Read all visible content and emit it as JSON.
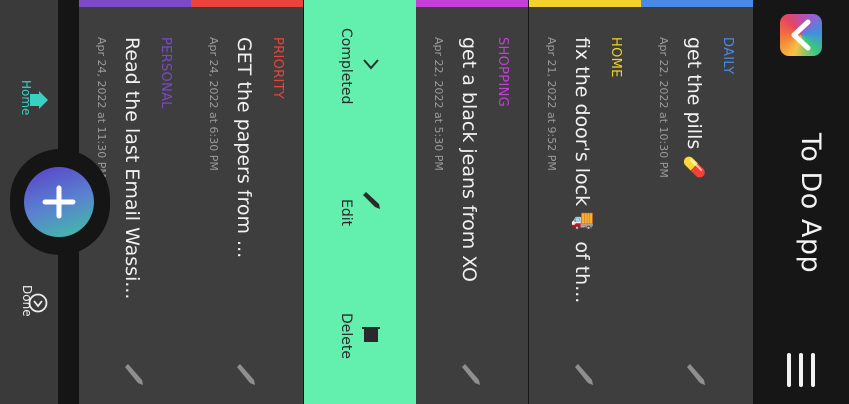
{
  "header": {
    "app_title": "To Do App",
    "logo_icon": "back-chevron-icon",
    "menu_icon": "hamburger-menu-icon"
  },
  "tasks": [
    {
      "category": "DAILY",
      "category_color": "#4a8ae6",
      "title": "get the pills 💊",
      "time": "Apr 22, 2022 at 10:30 PM"
    },
    {
      "category": "HOME",
      "category_color": "#f2d22b",
      "title": "fix the door's lock 🚚 of th...",
      "time": "Apr 21, 2022 at 9:52 PM"
    },
    {
      "category": "SHOPPING",
      "category_color": "#c43fd8",
      "title": "get a black jeans from XO",
      "time": "Apr 22, 2022 at 5:30 PM"
    },
    {
      "category": "PRIORITY",
      "category_color": "#e9433a",
      "title": "GET the papers from ...",
      "time": "Apr 24, 2022 at 6:30 PM"
    },
    {
      "category": "PERSONAL",
      "category_color": "#7c49c9",
      "title": "Read the last Email Wassi...",
      "time": "Apr 24, 2022 at 11:30 PM"
    }
  ],
  "actions": {
    "completed": "Completed",
    "edit": "Edit",
    "delete": "Delete",
    "panel_color": "#63efad"
  },
  "nav": {
    "home_label": "Home",
    "done_label": "Done",
    "active_color": "#39d0c2"
  }
}
